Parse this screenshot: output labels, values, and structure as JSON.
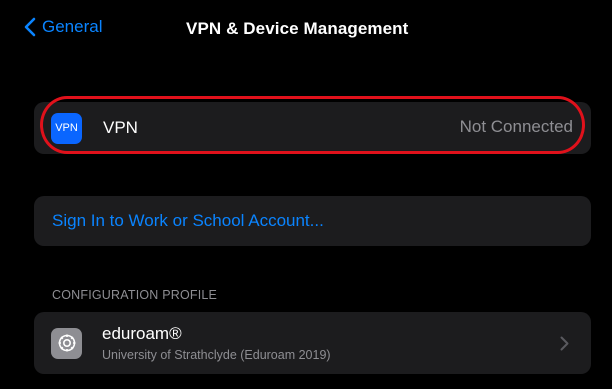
{
  "navbar": {
    "back_label": "General",
    "title": "VPN & Device Management"
  },
  "vpn": {
    "icon_text": "VPN",
    "label": "VPN",
    "status": "Not Connected"
  },
  "signin": {
    "label": "Sign In to Work or School Account..."
  },
  "configuration": {
    "section_header": "CONFIGURATION PROFILE",
    "profile_name": "eduroam®",
    "profile_subtitle": "University of Strathclyde (Eduroam 2019)"
  },
  "colors": {
    "background": "#000000",
    "cell": "#1c1c1e",
    "accent": "#0a84ff",
    "secondary_text": "#8e8e93",
    "highlight": "#e0111b",
    "vpn_icon": "#0a66ff"
  },
  "icons": {
    "back": "chevron-left-icon",
    "vpn": "vpn-icon",
    "profile": "gear-icon",
    "disclosure": "chevron-right-icon"
  }
}
